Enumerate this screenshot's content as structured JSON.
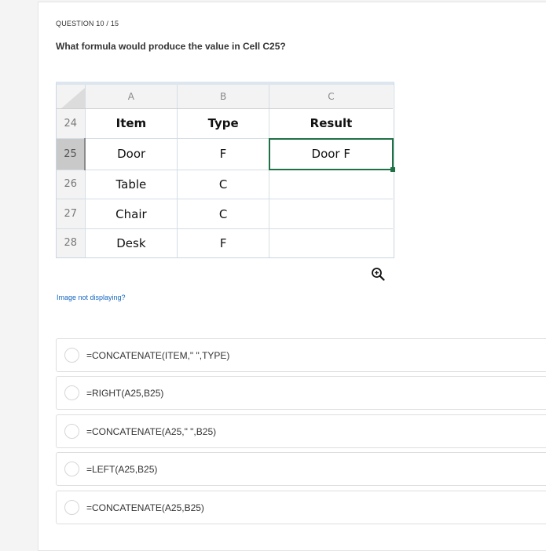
{
  "question": {
    "label": "QUESTION 10 / 15",
    "text": "What formula would produce the value in Cell C25?"
  },
  "sheet": {
    "columns": [
      "A",
      "B",
      "C"
    ],
    "rows": [
      {
        "num": "24",
        "cells": [
          "Item",
          "Type",
          "Result"
        ]
      },
      {
        "num": "25",
        "cells": [
          "Door",
          "F",
          "Door F"
        ]
      },
      {
        "num": "26",
        "cells": [
          "Table",
          "C",
          ""
        ]
      },
      {
        "num": "27",
        "cells": [
          "Chair",
          "C",
          ""
        ]
      },
      {
        "num": "28",
        "cells": [
          "Desk",
          "F",
          ""
        ]
      }
    ],
    "selected_cell": "C25",
    "accent_color": "#1e7145"
  },
  "zoom_icon": "zoom-in-icon",
  "image_help_link": "Image not displaying?",
  "options": [
    "=CONCATENATE(ITEM,\" \",TYPE)",
    "=RIGHT(A25,B25)",
    "=CONCATENATE(A25,\" \",B25)",
    "=LEFT(A25,B25)",
    "=CONCATENATE(A25,B25)"
  ]
}
